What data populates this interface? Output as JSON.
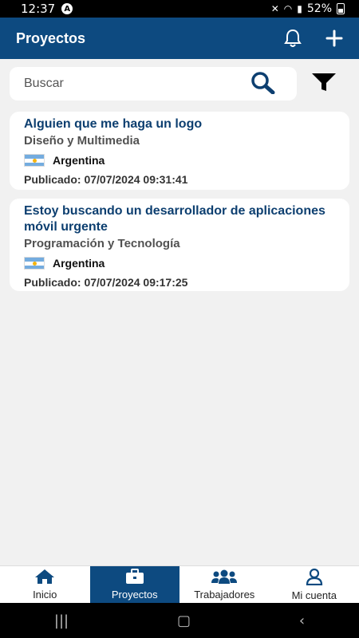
{
  "status": {
    "time": "12:37",
    "battery": "52%"
  },
  "appbar": {
    "title": "Proyectos"
  },
  "search": {
    "placeholder": "Buscar"
  },
  "projects": [
    {
      "title": "Alguien que me haga un logo",
      "category": "Diseño y Multimedia",
      "country": "Argentina",
      "published": "Publicado: 07/07/2024 09:31:41"
    },
    {
      "title": "Estoy buscando un desarrollador de aplicaciones móvil urgente",
      "category": "Programación y Tecnología",
      "country": "Argentina",
      "published": "Publicado: 07/07/2024 09:17:25"
    }
  ],
  "nav": [
    {
      "label": "Inicio",
      "icon": "home-icon"
    },
    {
      "label": "Proyectos",
      "icon": "briefcase-icon"
    },
    {
      "label": "Trabajadores",
      "icon": "users-icon"
    },
    {
      "label": "Mi cuenta",
      "icon": "user-icon"
    }
  ],
  "colors": {
    "primary": "#0d4a80",
    "title": "#0d3f70",
    "background": "#f1f1f1"
  }
}
